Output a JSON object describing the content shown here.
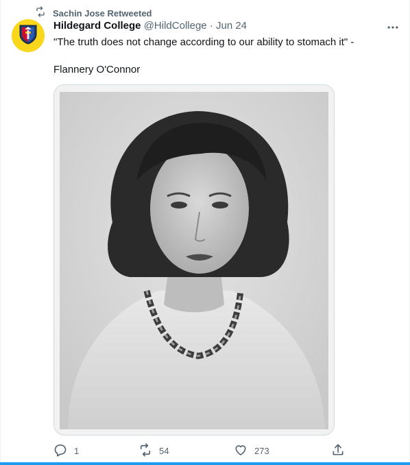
{
  "retweet": {
    "label": "Sachin Jose Retweeted",
    "icon": "retweet-icon"
  },
  "author": {
    "name": "Hildegard College",
    "handle": "@HildCollege",
    "date": "Jun 24",
    "separator": "·",
    "avatar_icon": "college-crest-logo",
    "avatar_bg": "#f9d71c"
  },
  "tweet": {
    "quote": "\"The truth does not change according to our ability to stomach it\" -",
    "attribution": "Flannery O'Connor"
  },
  "media": {
    "description_icon": "black-and-white-portrait-photo"
  },
  "actions": {
    "reply_count": "1",
    "retweet_count": "54",
    "like_count": "273",
    "share_icon": "share-icon"
  },
  "colors": {
    "secondary_text": "#536471",
    "primary_text": "#0f1419",
    "accent": "#1d9bf0"
  }
}
